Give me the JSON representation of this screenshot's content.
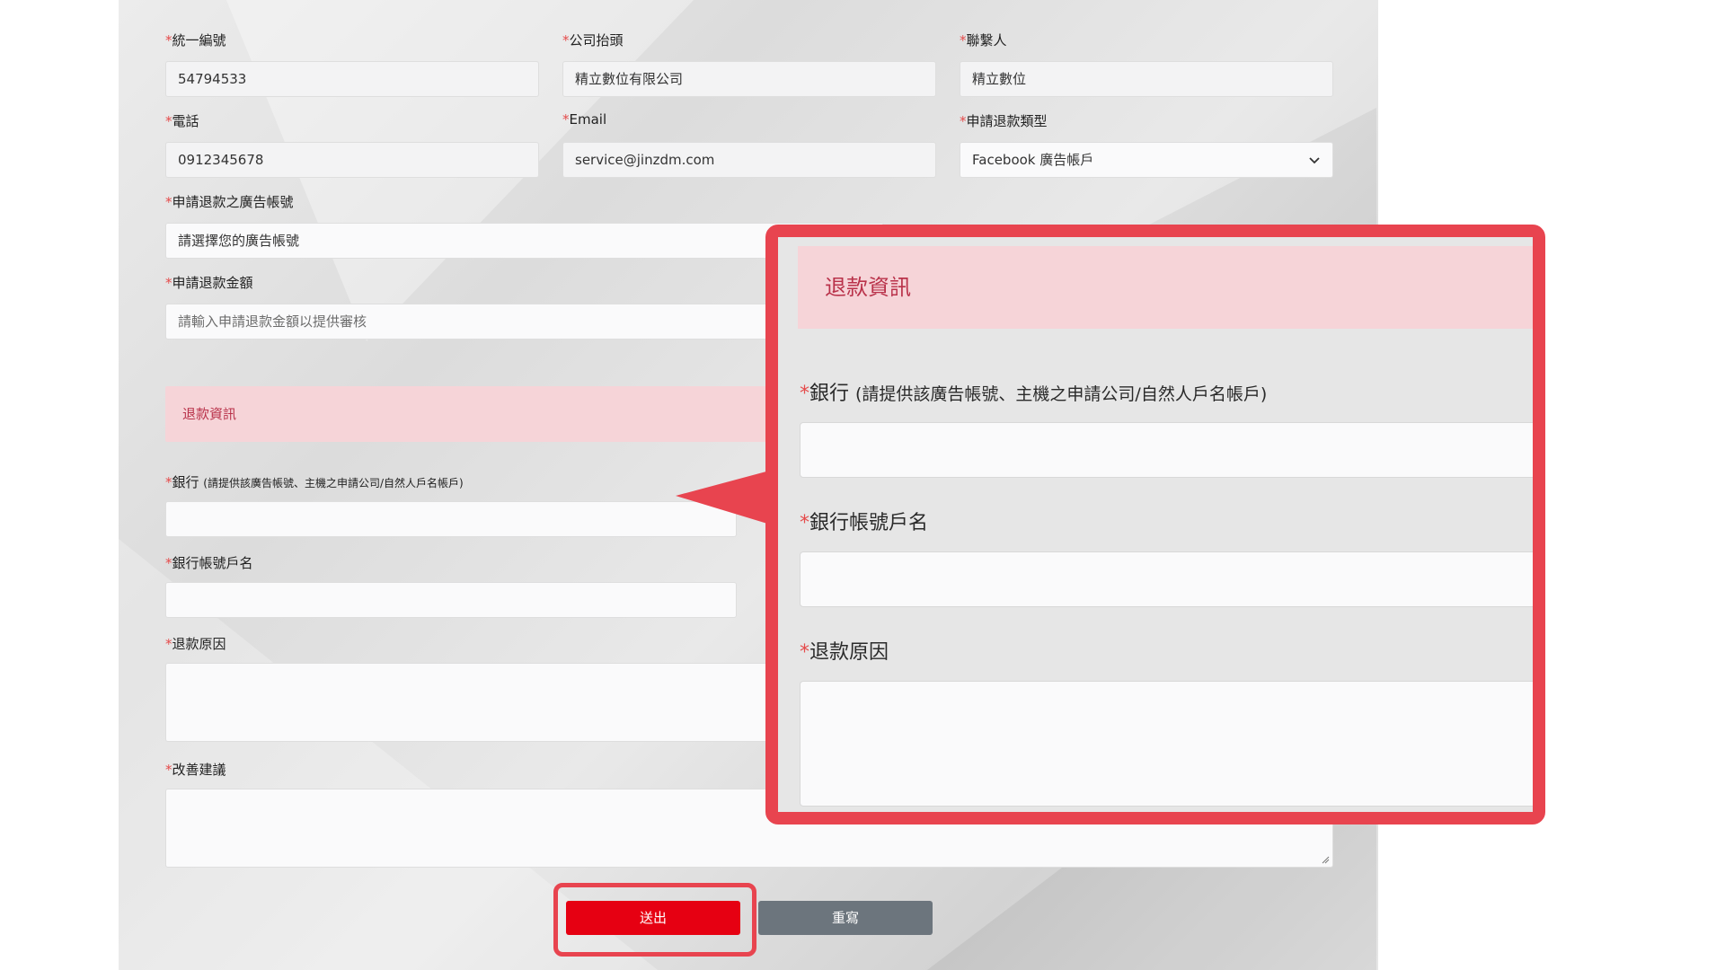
{
  "form": {
    "required_mark": "*",
    "tax_id": {
      "label": "統一編號",
      "value": "54794533"
    },
    "company": {
      "label": "公司抬頭",
      "value": "精立數位有限公司"
    },
    "contact": {
      "label": "聯繫人",
      "value": "精立數位"
    },
    "phone": {
      "label": "電話",
      "value": "0912345678"
    },
    "email": {
      "label": "Email",
      "value": "service@jinzdm.com"
    },
    "refund_type": {
      "label": "申請退款類型",
      "value": "Facebook 廣告帳戶"
    },
    "ad_account": {
      "label": "申請退款之廣告帳號",
      "value": "請選擇您的廣告帳號"
    },
    "refund_amount": {
      "label": "申請退款金額",
      "placeholder": "請輸入申請退款金額以提供審核"
    },
    "section_title": "退款資訊",
    "bank": {
      "label": "銀行",
      "hint": "(請提供該廣告帳號、主機之申請公司/自然人戶名帳戶)",
      "value": ""
    },
    "account_name": {
      "label": "銀行帳號戶名",
      "value": ""
    },
    "refund_reason": {
      "label": "退款原因",
      "value": ""
    },
    "suggestion": {
      "label": "改善建議",
      "value": ""
    }
  },
  "buttons": {
    "submit": "送出",
    "reset": "重寫"
  },
  "callout": {
    "section_title": "退款資訊",
    "bank_label": "銀行",
    "bank_hint": "(請提供該廣告帳號、主機之申請公司/自然人戶名帳戶)",
    "account_name_label": "銀行帳號戶名",
    "refund_reason_label": "退款原因"
  },
  "colors": {
    "accent_red": "#e60012",
    "highlight_border": "#e8444f",
    "section_bg": "#f6d4d8",
    "section_text": "#b9324a",
    "reset_gray": "#6c757d",
    "required_star": "#e54b4b"
  },
  "icons": {
    "dropdown": "chevron-down-icon",
    "resize": "resize-handle-icon",
    "pointer": "callout-arrow"
  }
}
